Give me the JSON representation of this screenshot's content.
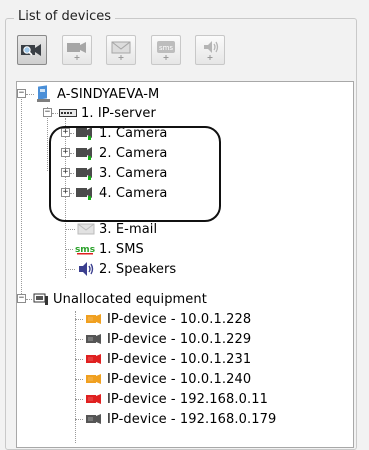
{
  "group_title": "List of devices",
  "toolbar": [
    {
      "name": "add-camera-button",
      "icon": "camera-search-icon"
    },
    {
      "name": "add-camera-plus-button",
      "icon": "camera-add-icon"
    },
    {
      "name": "add-email-button",
      "icon": "email-add-icon"
    },
    {
      "name": "add-sms-button",
      "icon": "sms-add-icon",
      "text": "sms"
    },
    {
      "name": "add-speaker-button",
      "icon": "speaker-add-icon"
    }
  ],
  "tree": {
    "root": "A-SINDYAEVA-M",
    "server": "1. IP-server",
    "cameras": [
      "1. Camera",
      "2. Camera",
      "3. Camera",
      "4. Camera"
    ],
    "email": "3. E-mail",
    "sms": "1. SMS",
    "sms_icon_text": "sms",
    "speakers": "2. Speakers",
    "unallocated": "Unallocated equipment",
    "devices": [
      {
        "label": "IP-device - 10.0.1.228",
        "status": "orange"
      },
      {
        "label": "IP-device - 10.0.1.229",
        "status": "gray"
      },
      {
        "label": "IP-device - 10.0.1.231",
        "status": "red"
      },
      {
        "label": "IP-device - 10.0.1.240",
        "status": "orange"
      },
      {
        "label": "IP-device - 192.168.0.11",
        "status": "red"
      },
      {
        "label": "IP-device - 192.168.0.179",
        "status": "gray"
      }
    ]
  },
  "colors": {
    "orange": "#f0a020",
    "red": "#e02020",
    "gray": "#555555",
    "green": "#19b019"
  }
}
